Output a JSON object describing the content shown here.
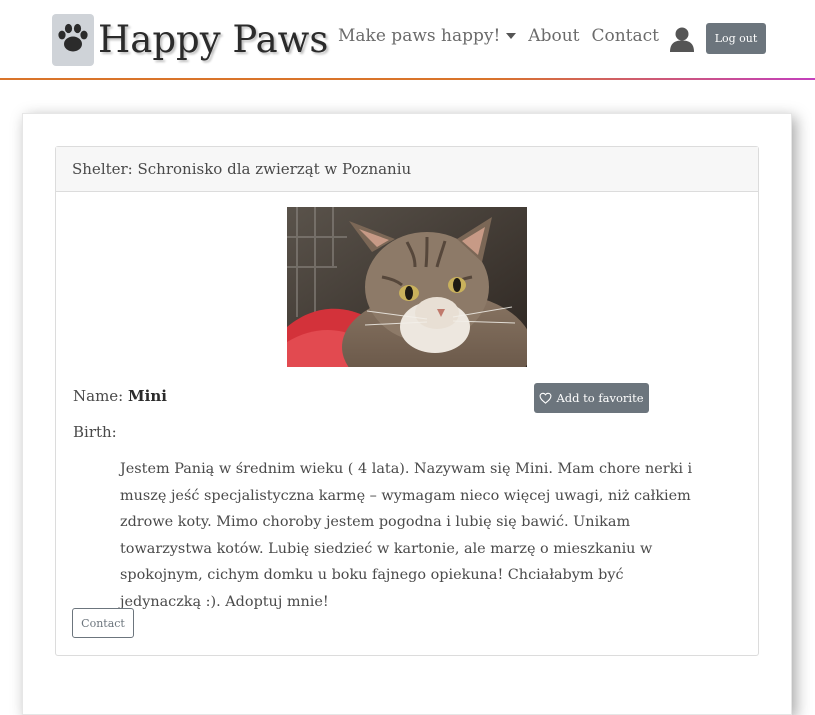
{
  "navbar": {
    "brand": "Happy Paws",
    "brand_icon": "paw-icon",
    "dropdown_label": "Make paws happy!",
    "about_label": "About",
    "contact_label": "Contact",
    "user_icon": "user-icon",
    "logout_label": "Log out",
    "rule_colors": [
      "#d9742a",
      "#c33fbd"
    ]
  },
  "pet": {
    "shelter_label": "Shelter: Schronisko dla zwierząt w Poznaniu",
    "name_label": "Name:",
    "name_value": "Mini",
    "birth_label": "Birth:",
    "favorite_label": "Add to favorite",
    "favorite_icon": "heart-icon",
    "description": "Jestem Panią w średnim wieku ( 4 lata). Nazywam się Mini. Mam chore nerki i muszę jeść specjalistyczna karmę – wymagam nieco więcej uwagi, niż całkiem zdrowe koty. Mimo choroby jestem pogodna i lubię się bawić. Unikam towarzystwa kotów. Lubię siedzieć w kartonie, ale marzę o mieszkaniu w spokojnym, cichym domku u boku fajnego opiekuna! Chciałabym być jedynaczką :). Adoptuj mnie!",
    "contact_label": "Contact"
  },
  "colors": {
    "button_gray": "#6c757d",
    "header_bg": "#f7f7f7"
  }
}
